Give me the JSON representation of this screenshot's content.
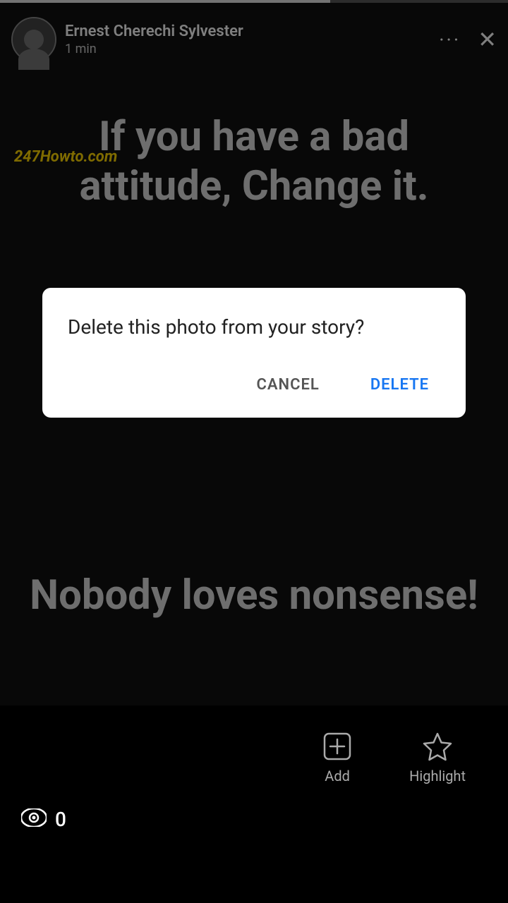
{
  "progress": {
    "fill_percent": 65
  },
  "header": {
    "user_name": "Ernest Cherechi Sylvester",
    "post_time": "1 min",
    "dots_label": "···",
    "close_label": "✕"
  },
  "watermark": {
    "text": "247Howto.com"
  },
  "story": {
    "top_text": "If you have a bad attitude, Change it.",
    "bottom_text": "Nobody loves nonsense!"
  },
  "dialog": {
    "message": "Delete this photo from your story?",
    "cancel_label": "CANCEL",
    "delete_label": "DELETE"
  },
  "bottom_bar": {
    "views_count": "0",
    "add_label": "Add",
    "highlight_label": "Highlight"
  },
  "colors": {
    "accent_blue": "#1877F2",
    "watermark_yellow": "#FFD700",
    "cancel_gray": "#555",
    "icon_gray": "#aaa"
  }
}
